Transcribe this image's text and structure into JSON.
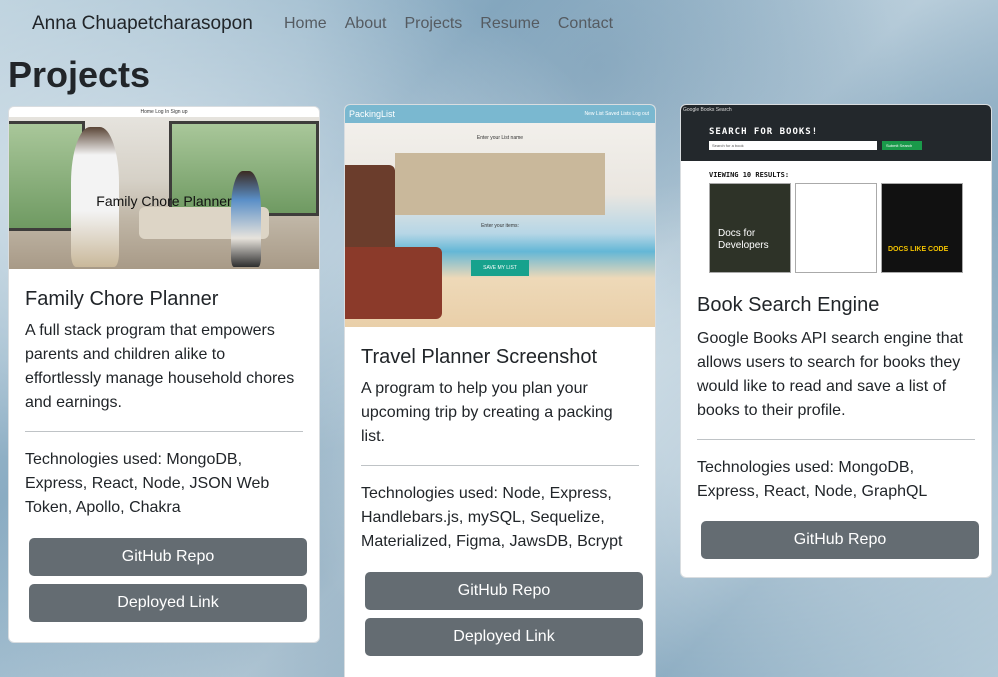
{
  "nav": {
    "brand": "Anna Chuapetcharasopon",
    "links": [
      "Home",
      "About",
      "Projects",
      "Resume",
      "Contact"
    ]
  },
  "page": {
    "title": "Projects"
  },
  "cards": [
    {
      "image_overlay": "Family Chore Planner",
      "image_topbar": "Home   Log In   Sign up",
      "title": "Family Chore Planner",
      "description": "A full stack program that empowers parents and children alike to effortlessly manage household chores and earnings.",
      "technologies": "Technologies used: MongoDB, Express, React, Node, JSON Web Token, Apollo, Chakra",
      "buttons": [
        "GitHub Repo",
        "Deployed Link"
      ]
    },
    {
      "image_brand": "PackingList",
      "image_nav": "New List   Saved Lists   Log out",
      "image_prompt": "Enter your List name",
      "image_items": "Enter your items:",
      "image_save": "SAVE MY LIST",
      "title": "Travel Planner Screenshot",
      "description": "A program to help you plan your upcoming trip by creating a packing list.",
      "technologies": "Technologies used: Node, Express, Handlebars.js, mySQL, Sequelize, Materialized, Figma, JawsDB, Bcrypt",
      "buttons": [
        "GitHub Repo",
        "Deployed Link"
      ]
    },
    {
      "image_brand": "Google Books Search",
      "image_heading": "SEARCH FOR BOOKS!",
      "image_search_placeholder": "Search for a book",
      "image_search_button": "Submit Search",
      "image_results": "VIEWING 10 RESULTS:",
      "image_book1": "Docs for Developers",
      "image_book3": "DOCS LIKE CODE",
      "title": "Book Search Engine",
      "description": "Google Books API search engine that allows users to search for books they would like to read and save a list of books to their profile.",
      "technologies": "Technologies used: MongoDB, Express, React, Node, GraphQL",
      "buttons": [
        "GitHub Repo"
      ]
    }
  ]
}
